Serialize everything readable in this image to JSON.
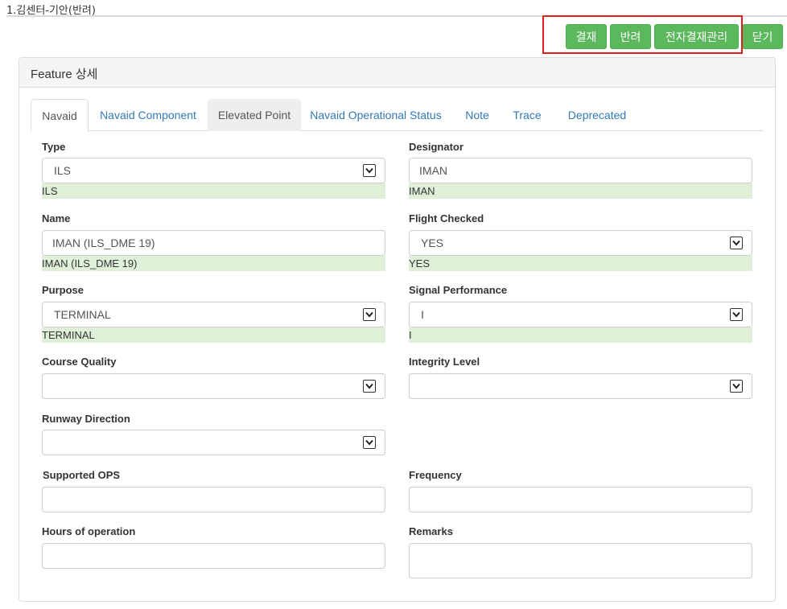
{
  "page": {
    "title": "1.김센터-기안(반려)"
  },
  "toolbar": {
    "approve_label": "결재",
    "reject_label": "반려",
    "e_approval_label": "전자결재관리",
    "close_label": "닫기",
    "button_color": "#5cb85c",
    "highlight_color": "#e02020"
  },
  "panel": {
    "heading": "Feature 상세"
  },
  "tabs": [
    {
      "label": "Navaid",
      "state": "active"
    },
    {
      "label": "Navaid Component",
      "state": "normal"
    },
    {
      "label": "Elevated Point",
      "state": "hover"
    },
    {
      "label": "Navaid Operational Status",
      "state": "normal"
    },
    {
      "label": "Note",
      "state": "normal"
    },
    {
      "label": "Trace",
      "state": "normal"
    },
    {
      "label": "Deprecated",
      "state": "normal"
    }
  ],
  "form": {
    "type": {
      "label": "Type",
      "value": "ILS",
      "saved": "ILS"
    },
    "designator": {
      "label": "Designator",
      "value": "IMAN",
      "saved": "IMAN"
    },
    "name": {
      "label": "Name",
      "value": "IMAN (ILS_DME 19)",
      "saved": "IMAN (ILS_DME 19)"
    },
    "flight_checked": {
      "label": "Flight Checked",
      "value": "YES",
      "saved": "YES"
    },
    "purpose": {
      "label": "Purpose",
      "value": "TERMINAL",
      "saved": "TERMINAL"
    },
    "signal_performance": {
      "label": "Signal Performance",
      "value": "I",
      "saved": "I"
    },
    "course_quality": {
      "label": "Course Quality",
      "value": ""
    },
    "integrity_level": {
      "label": "Integrity Level",
      "value": ""
    },
    "runway_direction": {
      "label": "Runway Direction",
      "value": ""
    },
    "supported_ops": {
      "label": "Supported OPS",
      "value": ""
    },
    "frequency": {
      "label": "Frequency",
      "value": ""
    },
    "hours_of_operation": {
      "label": "Hours of operation",
      "value": ""
    },
    "remarks": {
      "label": "Remarks",
      "value": ""
    }
  },
  "colors": {
    "saved_value_bg": "#dff0d8",
    "link": "#337ab7"
  }
}
